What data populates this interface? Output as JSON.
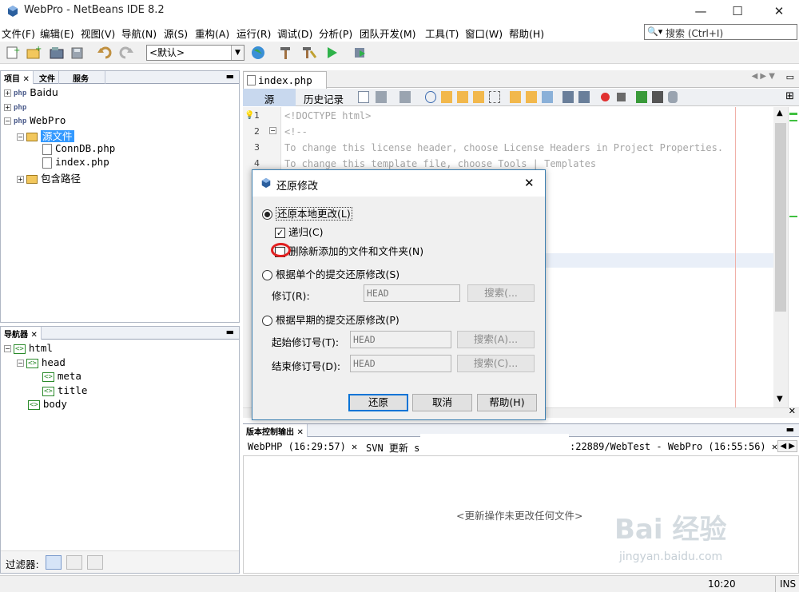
{
  "window": {
    "title": "WebPro - NetBeans IDE 8.2",
    "minimize": "—",
    "maximize": "☐",
    "close": "✕"
  },
  "menu": [
    "文件(F)",
    "编辑(E)",
    "视图(V)",
    "导航(N)",
    "源(S)",
    "重构(A)",
    "运行(R)",
    "调试(D)",
    "分析(P)",
    "团队开发(M)",
    "工具(T)",
    "窗口(W)",
    "帮助(H)"
  ],
  "search": {
    "placeholder": "搜索 (Ctrl+I)",
    "icon": "search-icon"
  },
  "toolbar": {
    "config_value": "<默认>"
  },
  "projects_panel": {
    "tabs": [
      "项目 ✕",
      "文件",
      "服务"
    ],
    "tree": [
      "Baidu",
      "WebPro",
      "源文件",
      "ConnDB.php",
      "index.php",
      "包含路径"
    ]
  },
  "navigator_panel": {
    "tab": "导航器 ✕",
    "tree": [
      "html",
      "head",
      "meta",
      "title",
      "body"
    ],
    "filter_label": "过滤器:"
  },
  "editor": {
    "file_tab": "index.php",
    "file_tab_close": "✕",
    "view_tabs": [
      "源",
      "历史记录"
    ],
    "line_numbers": [
      "1",
      "2",
      "3",
      "4"
    ],
    "lines": [
      "<!DOCTYPE html>",
      "<!--",
      "To change this license header, choose License Headers in Project Properties.",
      "To change this template file, choose Tools | Templates"
    ]
  },
  "output": {
    "header": "版本控制输出 ✕",
    "tabs": [
      "WebPHP (16:29:57) ✕",
      "SVN 更新 s",
      ":22889/WebTest - WebPro (16:55:56) ✕"
    ],
    "message": "<更新操作未更改任何文件>"
  },
  "dialog": {
    "title": "还原修改",
    "close": "✕",
    "option_local": "还原本地更改(L)",
    "recursive": "递归(C)",
    "delete_new": "删除新添加的文件和文件夹(N)",
    "option_single": "根据单个的提交还原修改(S)",
    "revision_label": "修订(R):",
    "revision_value": "HEAD",
    "search_button": "搜索(...",
    "option_earlier": "根据早期的提交还原修改(P)",
    "start_label": "起始修订号(T):",
    "start_value": "HEAD",
    "search_a_button": "搜索(A)...",
    "end_label": "结束修订号(D):",
    "end_value": "HEAD",
    "search_c_button": "搜索(C)...",
    "revert_button": "还原",
    "cancel_button": "取消",
    "help_button": "帮助(H)"
  },
  "status": {
    "position": "10:20",
    "mode": "INS"
  },
  "watermark": {
    "brand": "Bai 经验",
    "url": "jingyan.baidu.com"
  },
  "colors": {
    "accent": "#0a74d6",
    "selection": "#3399ff",
    "annotation_circle": "#e02020"
  }
}
